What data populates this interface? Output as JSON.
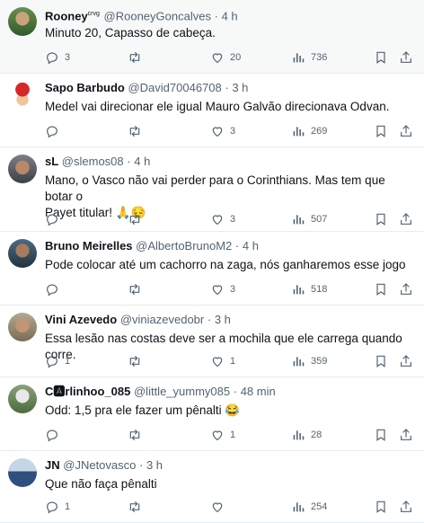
{
  "tweets": [
    {
      "name": "Rooney",
      "badge": "crvg",
      "handle": "@RooneyGoncalves",
      "dot": "·",
      "time": "4 h",
      "lines": [
        "Minuto 20, Capasso de cabeça."
      ],
      "replies": "3",
      "retweets": "",
      "likes": "20",
      "views": "736"
    },
    {
      "name": "Sapo Barbudo",
      "badge": "",
      "handle": "@David70046708",
      "dot": "·",
      "time": "3 h",
      "lines": [
        "Medel vai direcionar ele igual Mauro Galvão direcionava Odvan."
      ],
      "replies": "",
      "retweets": "",
      "likes": "3",
      "views": "269"
    },
    {
      "name": "sL",
      "badge": "",
      "handle": "@slemos08",
      "dot": "·",
      "time": "4 h",
      "lines": [
        "Mano, o Vasco não vai perder para o Corinthians. Mas tem que botar o",
        "Payet titular! 🙏😔"
      ],
      "replies": "",
      "retweets": "",
      "likes": "3",
      "views": "507"
    },
    {
      "name": "Bruno Meirelles",
      "badge": "",
      "handle": "@AlbertoBrunoM2",
      "dot": "·",
      "time": "4 h",
      "lines": [
        "Pode colocar até um cachorro na zaga, nós ganharemos esse jogo"
      ],
      "replies": "",
      "retweets": "",
      "likes": "3",
      "views": "518"
    },
    {
      "name": "Vini Azevedo",
      "badge": "",
      "handle": "@viniazevedobr",
      "dot": "·",
      "time": "3 h",
      "lines": [
        "Essa lesão nas costas deve ser a mochila que ele carrega quando corre."
      ],
      "replies": "1",
      "retweets": "",
      "likes": "1",
      "views": "359"
    },
    {
      "name": "C🅰rlinhoo_085",
      "badge": "",
      "handle": "@little_yummy085",
      "dot": "·",
      "time": "48 min",
      "lines": [
        "Odd: 1,5 pra ele fazer um pênalti 😂"
      ],
      "replies": "",
      "retweets": "",
      "likes": "1",
      "views": "28"
    },
    {
      "name": "JN",
      "badge": "",
      "handle": "@JNetovasco",
      "dot": "·",
      "time": "3 h",
      "lines": [
        "Que não faça pênalti"
      ],
      "replies": "1",
      "retweets": "",
      "likes": "",
      "views": "254"
    }
  ],
  "icons": {
    "reply": "reply-icon",
    "retweet": "retweet-icon",
    "like": "heart-icon",
    "views": "views-icon",
    "bookmark": "bookmark-icon",
    "share": "share-icon"
  },
  "colors": {
    "icon": "#536471",
    "border": "#e6ecf0",
    "text": "#0f1419",
    "secondary": "#536471"
  }
}
